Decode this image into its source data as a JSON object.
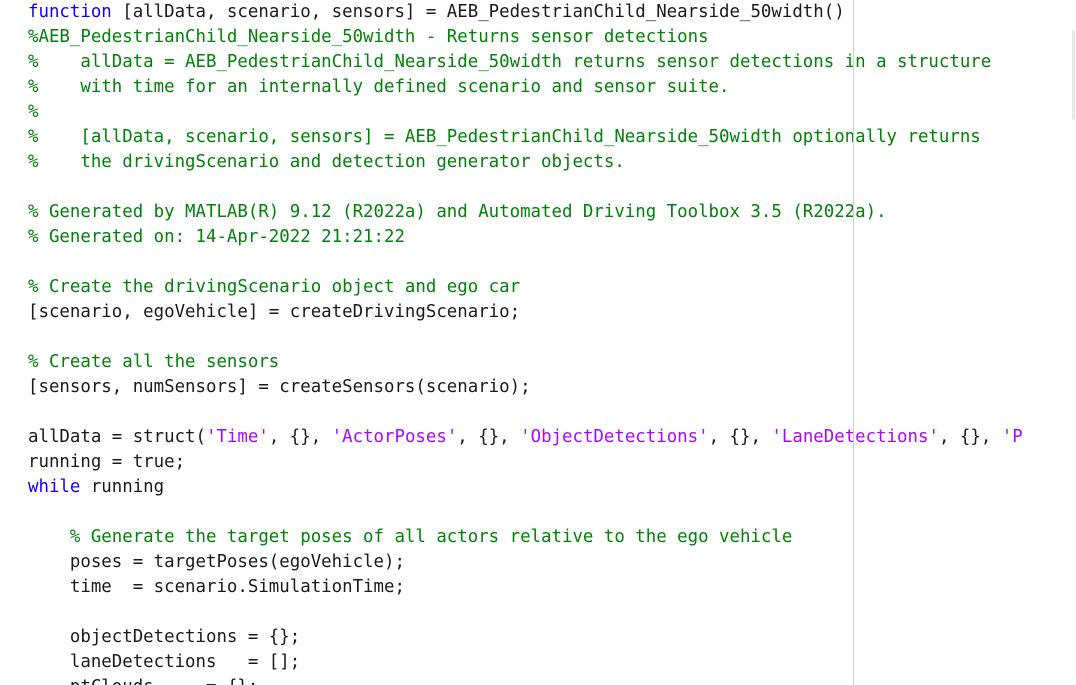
{
  "editor": {
    "lines": [
      [
        {
          "t": "function",
          "c": "kw"
        },
        {
          "t": " [allData, scenario, sensors] = AEB_PedestrianChild_Nearside_50width()",
          "c": "txt"
        }
      ],
      [
        {
          "t": "%AEB_PedestrianChild_Nearside_50width - Returns sensor detections",
          "c": "cm"
        }
      ],
      [
        {
          "t": "%    allData = AEB_PedestrianChild_Nearside_50width returns sensor detections in a structure",
          "c": "cm"
        }
      ],
      [
        {
          "t": "%    with time for an internally defined scenario and sensor suite.",
          "c": "cm"
        }
      ],
      [
        {
          "t": "%",
          "c": "cm"
        }
      ],
      [
        {
          "t": "%    [allData, scenario, sensors] = AEB_PedestrianChild_Nearside_50width optionally returns",
          "c": "cm"
        }
      ],
      [
        {
          "t": "%    the drivingScenario and detection generator objects.",
          "c": "cm"
        }
      ],
      [],
      [
        {
          "t": "% Generated by MATLAB(R) 9.12 (R2022a) and Automated Driving Toolbox 3.5 (R2022a).",
          "c": "cm"
        }
      ],
      [
        {
          "t": "% Generated on: 14-Apr-2022 21:21:22",
          "c": "cm"
        }
      ],
      [],
      [
        {
          "t": "% Create the drivingScenario object and ego car",
          "c": "cm"
        }
      ],
      [
        {
          "t": "[scenario, egoVehicle] = createDrivingScenario;",
          "c": "txt"
        }
      ],
      [],
      [
        {
          "t": "% Create all the sensors",
          "c": "cm"
        }
      ],
      [
        {
          "t": "[sensors, numSensors] = createSensors(scenario);",
          "c": "txt"
        }
      ],
      [],
      [
        {
          "t": "allData = struct(",
          "c": "txt"
        },
        {
          "t": "'Time'",
          "c": "str"
        },
        {
          "t": ", {}, ",
          "c": "txt"
        },
        {
          "t": "'ActorPoses'",
          "c": "str"
        },
        {
          "t": ", {}, ",
          "c": "txt"
        },
        {
          "t": "'ObjectDetections'",
          "c": "str"
        },
        {
          "t": ", {}, ",
          "c": "txt"
        },
        {
          "t": "'LaneDetections'",
          "c": "str"
        },
        {
          "t": ", {}, ",
          "c": "txt"
        },
        {
          "t": "'P",
          "c": "str"
        }
      ],
      [
        {
          "t": "running = true;",
          "c": "txt"
        }
      ],
      [
        {
          "t": "while",
          "c": "kw"
        },
        {
          "t": " running",
          "c": "txt"
        }
      ],
      [],
      [
        {
          "t": "    % Generate the target poses of all actors relative to the ego vehicle",
          "c": "cm"
        }
      ],
      [
        {
          "t": "    poses = targetPoses(egoVehicle);",
          "c": "txt"
        }
      ],
      [
        {
          "t": "    time  = scenario.SimulationTime;",
          "c": "txt"
        }
      ],
      [],
      [
        {
          "t": "    objectDetections = {};",
          "c": "txt"
        }
      ],
      [
        {
          "t": "    laneDetections   = [];",
          "c": "txt"
        }
      ],
      [
        {
          "t": "    ptClouds     = {};",
          "c": "txt"
        }
      ]
    ]
  }
}
